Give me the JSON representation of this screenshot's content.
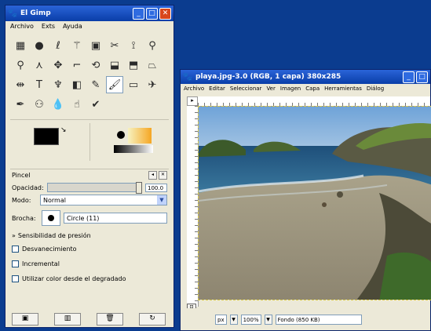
{
  "toolbox": {
    "title": "El Gimp",
    "menu": [
      "Archivo",
      "Exts",
      "Ayuda"
    ],
    "tools": [
      {
        "icon": "rect-select-icon",
        "glyph": "▦"
      },
      {
        "icon": "ellipse-select-icon",
        "glyph": "●"
      },
      {
        "icon": "lasso-icon",
        "glyph": "ℓ"
      },
      {
        "icon": "magic-wand-icon",
        "glyph": "⚚"
      },
      {
        "icon": "color-select-icon",
        "glyph": "▣"
      },
      {
        "icon": "scissors-icon",
        "glyph": "✂"
      },
      {
        "icon": "paths-icon",
        "glyph": "⟟"
      },
      {
        "icon": "color-picker-icon",
        "glyph": "⚲"
      },
      {
        "icon": "zoom-icon",
        "glyph": "⚲"
      },
      {
        "icon": "measure-icon",
        "glyph": "⋏"
      },
      {
        "icon": "move-icon",
        "glyph": "✥"
      },
      {
        "icon": "crop-icon",
        "glyph": "⌐"
      },
      {
        "icon": "rotate-icon",
        "glyph": "⟲"
      },
      {
        "icon": "scale-icon",
        "glyph": "⬓"
      },
      {
        "icon": "shear-icon",
        "glyph": "⬒"
      },
      {
        "icon": "perspective-icon",
        "glyph": "⏢"
      },
      {
        "icon": "flip-icon",
        "glyph": "⇹"
      },
      {
        "icon": "text-icon",
        "glyph": "T"
      },
      {
        "icon": "bucket-fill-icon",
        "glyph": "♆"
      },
      {
        "icon": "blend-icon",
        "glyph": "◧"
      },
      {
        "icon": "pencil-icon",
        "glyph": "✎"
      },
      {
        "icon": "paintbrush-icon",
        "glyph": "🖌"
      },
      {
        "icon": "eraser-icon",
        "glyph": "▭"
      },
      {
        "icon": "airbrush-icon",
        "glyph": "✈"
      },
      {
        "icon": "ink-icon",
        "glyph": "✒"
      },
      {
        "icon": "clone-icon",
        "glyph": "⚇"
      },
      {
        "icon": "blur-icon",
        "glyph": "💧"
      },
      {
        "icon": "smudge-icon",
        "glyph": "☝"
      },
      {
        "icon": "dodge-burn-icon",
        "glyph": "✔"
      }
    ],
    "options": {
      "title": "Pincel",
      "opacity_label": "Opacidad:",
      "opacity_value": "100.0",
      "opacity_fraction": 1.0,
      "mode_label": "Modo:",
      "mode_value": "Normal",
      "brush_label": "Brocha:",
      "brush_name": "Circle (11)",
      "pressure_label": "Sensibilidad de presión",
      "fade_label": "Desvanecimiento",
      "incremental_label": "Incremental",
      "gradient_label": "Utilizar color desde el degradado"
    },
    "buttons": [
      {
        "icon": "save-icon",
        "glyph": "▣"
      },
      {
        "icon": "restore-icon",
        "glyph": "▥"
      },
      {
        "icon": "delete-icon",
        "glyph": "🗑"
      },
      {
        "icon": "reset-icon",
        "glyph": "↻"
      }
    ]
  },
  "image_window": {
    "title": "playa.jpg-3.0 (RGB, 1 capa) 380x285",
    "menu": [
      "Archivo",
      "Editar",
      "Seleccionar",
      "Ver",
      "Imagen",
      "Capa",
      "Herramientas",
      "Diálog"
    ],
    "unit": "px",
    "zoom": "100%",
    "layer_info": "Fondo (850 KB)"
  },
  "colors": {
    "title_bar": "#0a3ea8",
    "desktop": "#0b3c8f",
    "panel": "#ece9d8",
    "close_button": "#d9471c"
  }
}
